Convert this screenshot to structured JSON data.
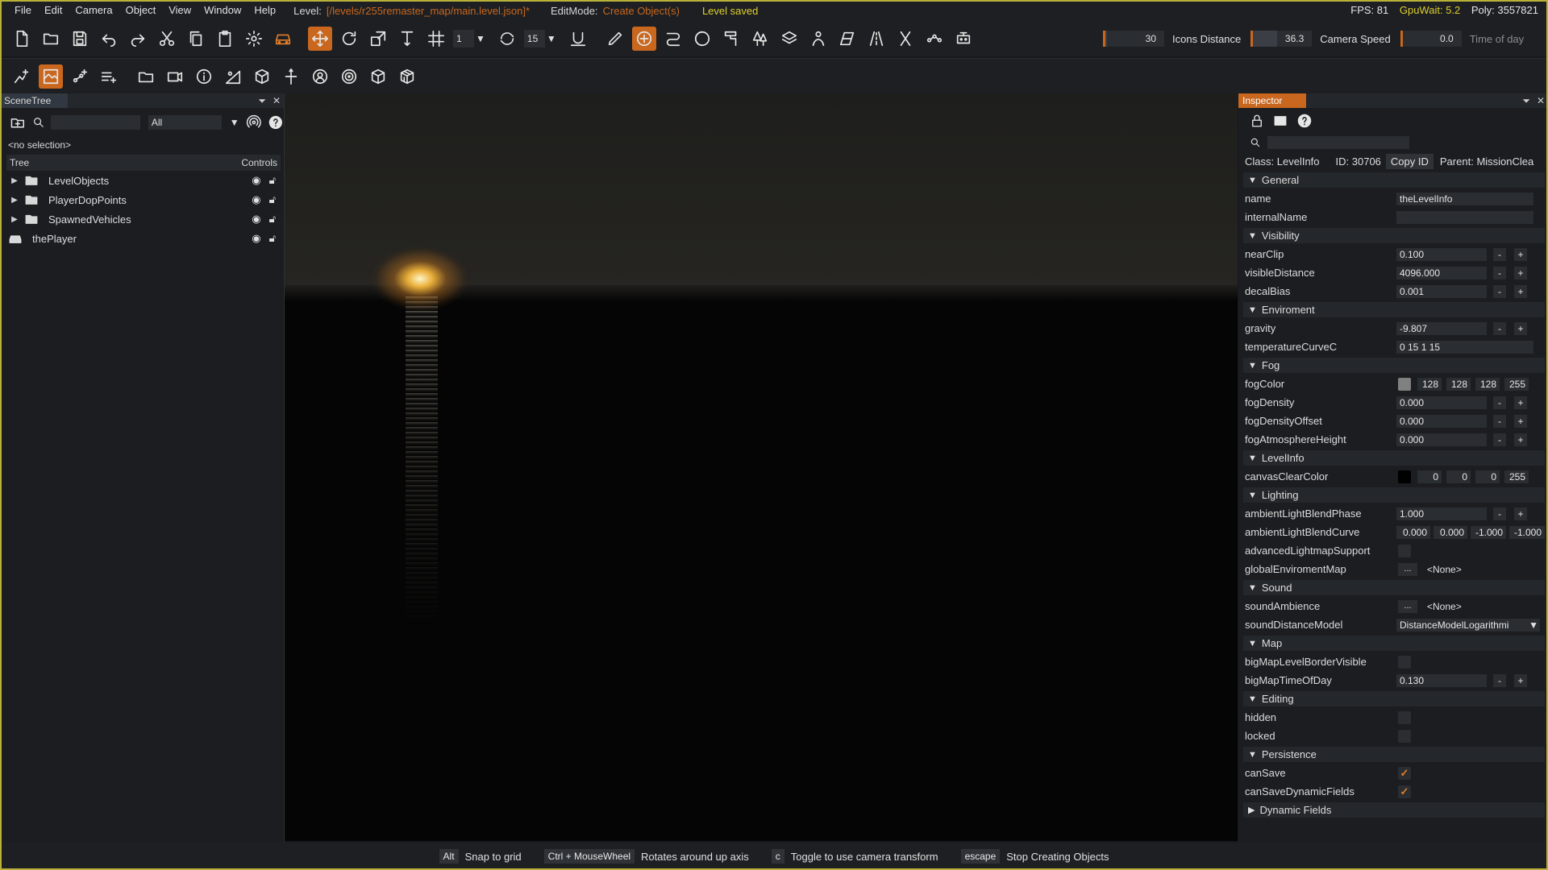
{
  "menubar": {
    "items": [
      "File",
      "Edit",
      "Camera",
      "Object",
      "View",
      "Window",
      "Help"
    ],
    "level_label": "Level:",
    "level_path": "[/levels/r255remaster_map/main.level.json]*",
    "editmode_label": "EditMode:",
    "editmode_value": "Create Object(s)",
    "status": "Level saved",
    "fps": "FPS: 81",
    "gpuwait": "GpuWait: 5.2",
    "poly": "Poly: 3557821"
  },
  "toolbar": {
    "snap_value": "1",
    "rotate_value": "15",
    "slider1_value": "30",
    "icons_distance_value": "36.3",
    "icons_distance_label": "Icons Distance",
    "camera_speed_value": "0.0",
    "camera_speed_label": "Camera Speed",
    "time_of_day_label": "Time of day",
    "accent_color": "#c9671f"
  },
  "scenetree": {
    "title": "SceneTree",
    "filter": "All",
    "no_selection": "<no selection>",
    "col_tree": "Tree",
    "col_controls": "Controls",
    "items": [
      {
        "label": "LevelObjects",
        "icon": "folder-icon"
      },
      {
        "label": "PlayerDopPoints",
        "icon": "folder-icon"
      },
      {
        "label": "SpawnedVehicles",
        "icon": "folder-icon"
      },
      {
        "label": "thePlayer",
        "icon": "car-icon"
      }
    ]
  },
  "inspector": {
    "title": "Inspector",
    "class_label": "Class:",
    "class_value": "LevelInfo",
    "id_label": "ID:",
    "id_value": "30706",
    "copy_id": "Copy ID",
    "parent_label": "Parent:",
    "parent_value": "MissionClea",
    "sections": {
      "general": "General",
      "visibility": "Visibility",
      "environment": "Enviroment",
      "fog": "Fog",
      "levelinfo": "LevelInfo",
      "lighting": "Lighting",
      "sound": "Sound",
      "map": "Map",
      "editing": "Editing",
      "persistence": "Persistence",
      "dynamic": "Dynamic Fields"
    },
    "props": {
      "name": {
        "label": "name",
        "value": "theLevelInfo"
      },
      "internalName": {
        "label": "internalName",
        "value": ""
      },
      "nearClip": {
        "label": "nearClip",
        "value": "0.100"
      },
      "visibleDistance": {
        "label": "visibleDistance",
        "value": "4096.000"
      },
      "decalBias": {
        "label": "decalBias",
        "value": "0.001"
      },
      "gravity": {
        "label": "gravity",
        "value": "-9.807"
      },
      "temperatureCurveC": {
        "label": "temperatureCurveC",
        "value": "0 15 1 15"
      },
      "fogColor": {
        "label": "fogColor",
        "r": "128",
        "g": "128",
        "b": "128",
        "a": "255",
        "swatch": "#808080"
      },
      "fogDensity": {
        "label": "fogDensity",
        "value": "0.000"
      },
      "fogDensityOffset": {
        "label": "fogDensityOffset",
        "value": "0.000"
      },
      "fogAtmosphereHeight": {
        "label": "fogAtmosphereHeight",
        "value": "0.000"
      },
      "canvasClearColor": {
        "label": "canvasClearColor",
        "r": "0",
        "g": "0",
        "b": "0",
        "a": "255",
        "swatch": "#000000"
      },
      "ambientLightBlendPhase": {
        "label": "ambientLightBlendPhase",
        "value": "1.000"
      },
      "ambientLightBlendCurve": {
        "label": "ambientLightBlendCurve",
        "v1": "0.000",
        "v2": "0.000",
        "v3": "-1.000",
        "v4": "-1.000"
      },
      "advancedLightmapSupport": {
        "label": "advancedLightmapSupport"
      },
      "globalEnviromentMap": {
        "label": "globalEnviromentMap",
        "btn": "...",
        "value": "<None>"
      },
      "soundAmbience": {
        "label": "soundAmbience",
        "btn": "...",
        "value": "<None>"
      },
      "soundDistanceModel": {
        "label": "soundDistanceModel",
        "value": "DistanceModelLogarithmi"
      },
      "bigMapLevelBorderVisible": {
        "label": "bigMapLevelBorderVisible"
      },
      "bigMapTimeOfDay": {
        "label": "bigMapTimeOfDay",
        "value": "0.130"
      },
      "hidden": {
        "label": "hidden"
      },
      "locked": {
        "label": "locked"
      },
      "canSave": {
        "label": "canSave",
        "check": "✓"
      },
      "canSaveDynamicFields": {
        "label": "canSaveDynamicFields",
        "check": "✓"
      }
    },
    "minus": "-",
    "plus": "+"
  },
  "statusbar": {
    "hints": [
      {
        "key": "Alt",
        "text": "Snap to grid"
      },
      {
        "key": "Ctrl + MouseWheel",
        "text": "Rotates around up axis"
      },
      {
        "key": "c",
        "text": "Toggle to use camera transform"
      },
      {
        "key": "escape",
        "text": "Stop Creating Objects"
      }
    ]
  }
}
